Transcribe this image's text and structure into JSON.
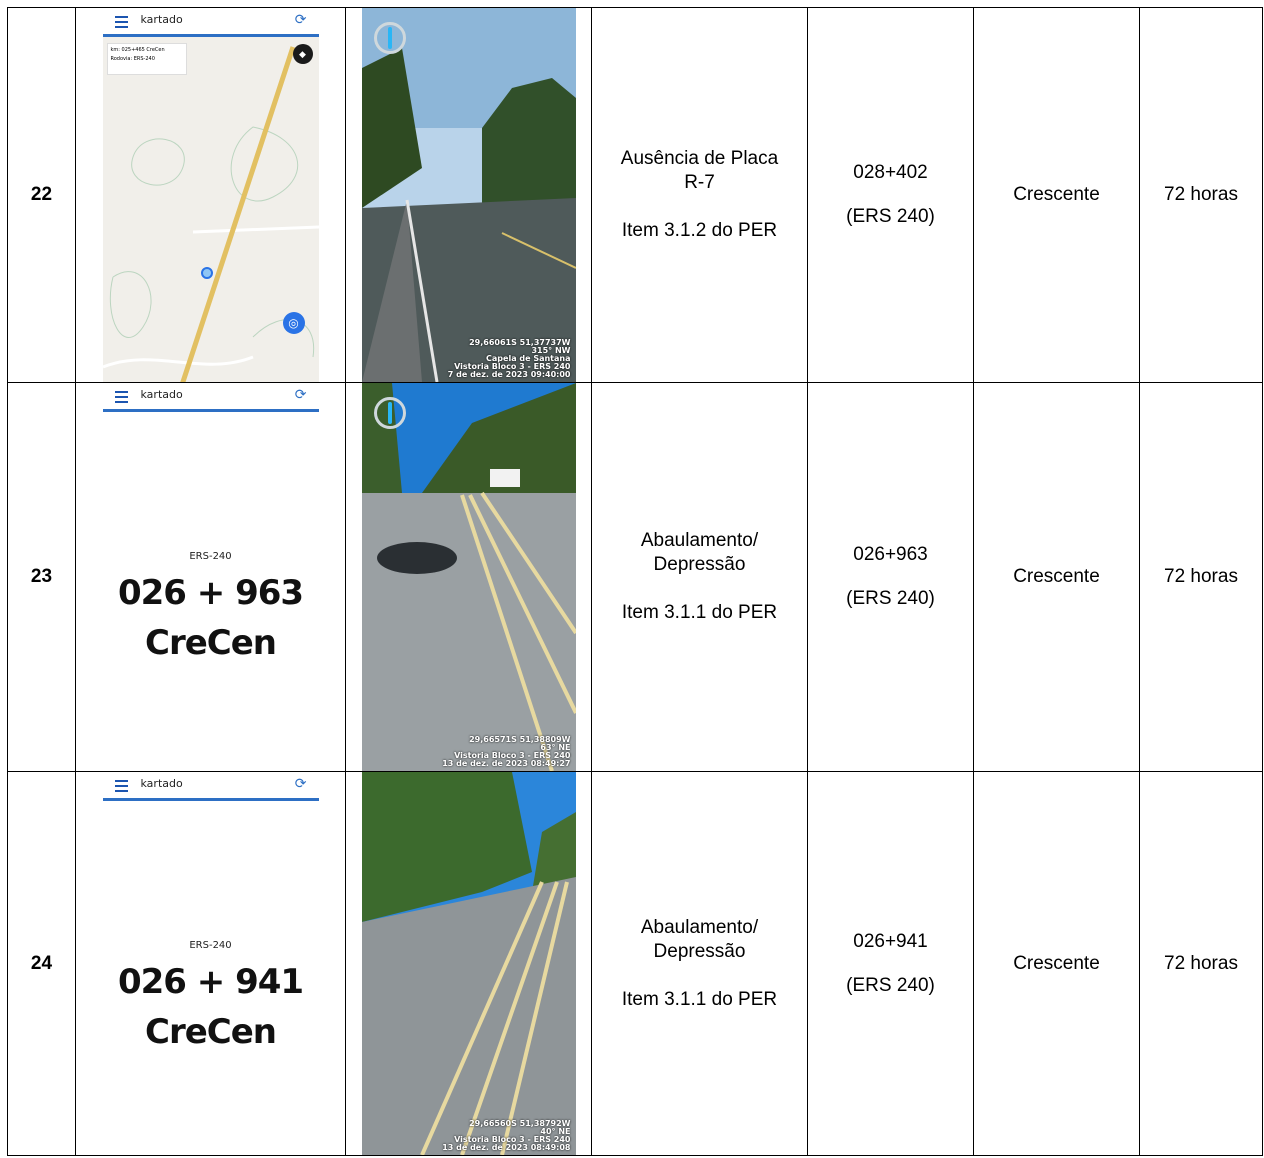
{
  "app": {
    "name": "kartado"
  },
  "colors": {
    "accent": "#2d6fc4",
    "road": "#e2c062",
    "marker": "#2a73e6"
  },
  "icons": {
    "menu": "menu-icon",
    "sync": "sync-icon",
    "compass": "compass-icon",
    "locate": "locate-icon"
  },
  "rows": [
    {
      "number": "22",
      "map_info": {
        "km": "km: 025+465 CreCen",
        "rodovia": "Rodovia: ERS-240"
      },
      "photo_stamp": [
        "29,66061S 51,37737W",
        "315° NW",
        "Capela de Santana",
        "Vistoria Bloco 3 - ERS 240",
        "7 de dez. de 2023 09:40:00"
      ],
      "description": {
        "line1": "Ausência de Placa",
        "line2": "R-7",
        "item": "Item 3.1.2 do PER"
      },
      "km": "028+402",
      "road": "(ERS 240)",
      "direction": "Crescente",
      "deadline": "72 horas"
    },
    {
      "number": "23",
      "panel": {
        "road": "ERS-240",
        "km": "026 + 963",
        "dir": "CreCen"
      },
      "photo_stamp": [
        "29,66571S 51,38809W",
        "63° NE",
        "Vistoria Bloco 3 - ERS 240",
        "13 de dez. de 2023 08:49:27"
      ],
      "description": {
        "line1": "Abaulamento/",
        "line2": "Depressão",
        "item": "Item 3.1.1 do PER"
      },
      "km": "026+963",
      "road": "(ERS 240)",
      "direction": "Crescente",
      "deadline": "72 horas"
    },
    {
      "number": "24",
      "panel": {
        "road": "ERS-240",
        "km": "026 + 941",
        "dir": "CreCen"
      },
      "photo_stamp": [
        "29,66560S 51,38792W",
        "40° NE",
        "Vistoria Bloco 3 - ERS 240",
        "13 de dez. de 2023 08:49:08"
      ],
      "description": {
        "line1": "Abaulamento/",
        "line2": "Depressão",
        "item": "Item 3.1.1 do PER"
      },
      "km": "026+941",
      "road": "(ERS 240)",
      "direction": "Crescente",
      "deadline": "72 horas"
    }
  ]
}
